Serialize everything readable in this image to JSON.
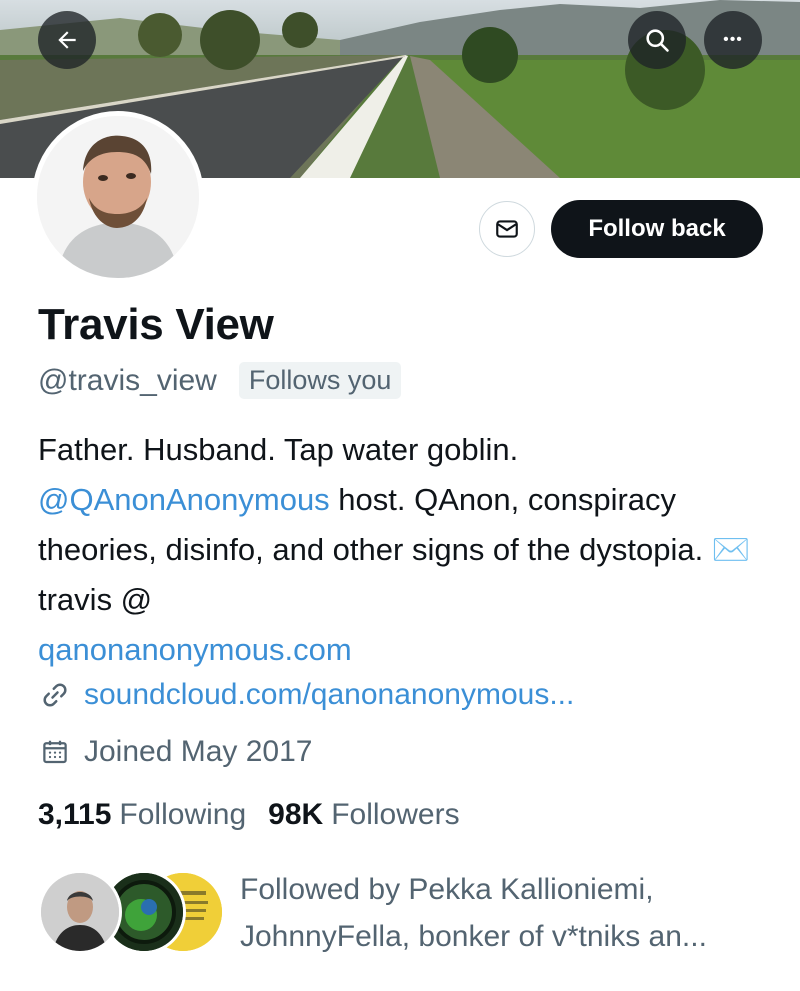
{
  "header": {
    "back_icon": "arrow-left-icon",
    "search_icon": "search-icon",
    "more_icon": "more-horizontal-icon",
    "more_glyph": "•••"
  },
  "profile": {
    "name": "Travis View",
    "handle": "@travis_view",
    "follows_you_badge": "Follows you",
    "follow_button_label": "Follow back",
    "message_icon": "mail-icon"
  },
  "bio": {
    "line1": "Father. Husband. Tap water goblin.",
    "mention": "@QAnonAnonymous",
    "after_mention": " host. QAnon, conspiracy theories, disinfo, and other signs of the dystopia. ",
    "envelope_emoji": "✉️",
    "email_prefix": " travis @",
    "email_domain": "qanonanonymous.com"
  },
  "meta": {
    "link_icon": "link-icon",
    "link_text": "soundcloud.com/qanonanonymous...",
    "calendar_icon": "calendar-icon",
    "joined_text": "Joined May 2017"
  },
  "stats": {
    "following_count": "3,115",
    "following_label": "Following",
    "followers_count": "98K",
    "followers_label": "Followers"
  },
  "followed_by": {
    "text": "Followed by Pekka Kallioniemi, JohnnyFella, bonker of v*tniks an..."
  },
  "colors": {
    "accent_link": "#3b8fd6",
    "primary_text": "#0f1419",
    "secondary_text": "#536471",
    "button_dark": "#0f1419"
  }
}
